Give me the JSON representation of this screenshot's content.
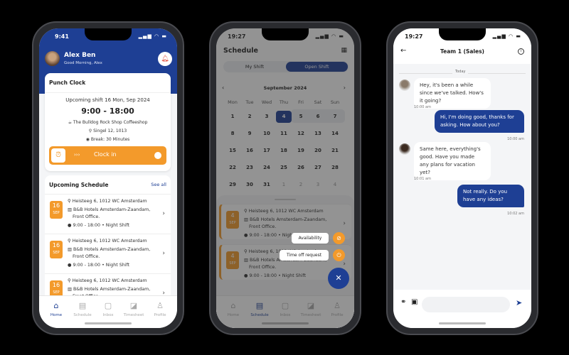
{
  "colors": {
    "primary": "#1e3f94",
    "accent": "#f39a2b",
    "background": "#000000"
  },
  "home": {
    "status_time": "9:41",
    "user_name": "Alex Ben",
    "greeting": "Good Morning, Alex",
    "punch_clock": {
      "title": "Punch Clock",
      "upcoming": "Upcoming shift 16 Mon, Sep 2024",
      "time": "9:00 - 18:00",
      "shop": "The Bulldog Rock Shop Coffeeshop",
      "address": "Singel 12, 1013",
      "break": "Break: 30 Minutes",
      "clock_in": "Clock in",
      "arrows": "›››"
    },
    "schedule": {
      "title": "Upcoming Schedule",
      "see_all": "See all",
      "items": [
        {
          "day": "16",
          "month": "SEP",
          "address": "Heisteeg 6, 1012 WC Amsterdam",
          "hotel": "B&B Hotels Amsterdam-Zaandam,",
          "dept": "Front Office.",
          "shift": "9:00 - 18:00 • Night Shift"
        },
        {
          "day": "16",
          "month": "SEP",
          "address": "Heisteeg 6, 1012 WC Amsterdam",
          "hotel": "B&B Hotels Amsterdam-Zaandam,",
          "dept": "Front Office.",
          "shift": "9:00 - 18:00 • Night Shift"
        },
        {
          "day": "16",
          "month": "SEP",
          "address": "Heisteeg 6, 1012 WC Amsterdam",
          "hotel": "B&B Hotels Amsterdam-Zaandam,",
          "dept": "Front Office.",
          "shift": "9:00 - 18:00 • Night Shift"
        }
      ]
    }
  },
  "nav": [
    "Home",
    "Schedule",
    "Inbox",
    "Timesheet",
    "Profile"
  ],
  "schedule_screen": {
    "status_time": "19:27",
    "title": "Schedule",
    "tabs": [
      "My Shift",
      "Open Shift"
    ],
    "active_tab": "Open Shift",
    "month": "September 2024",
    "weekdays": [
      "Mon",
      "Tue",
      "Wed",
      "Thu",
      "Fri",
      "Sat",
      "Sun"
    ],
    "weeks": [
      [
        "1",
        "2",
        "3",
        "4",
        "5",
        "6",
        "7"
      ],
      [
        "8",
        "9",
        "10",
        "11",
        "12",
        "13",
        "14"
      ],
      [
        "15",
        "16",
        "17",
        "18",
        "19",
        "20",
        "21"
      ],
      [
        "22",
        "23",
        "24",
        "25",
        "26",
        "27",
        "28"
      ],
      [
        "29",
        "30",
        "31",
        "1",
        "2",
        "3",
        "4"
      ]
    ],
    "selected_day": "4",
    "items": [
      {
        "day": "4",
        "month": "SEP",
        "address": "Heisteeg 6, 1012 WC Amsterdam",
        "hotel": "B&B Hotels Amsterdam-Zaandam,",
        "dept": "Front Office.",
        "shift": "9:00 - 18:00 • Night Shift"
      },
      {
        "day": "4",
        "month": "SEP",
        "address": "Heisteeg 6, 1012 WC Amsterdam",
        "hotel": "B&B Hotels Amsterdam-Zaandam,",
        "dept": "Front Office.",
        "shift": "9:00 - 18:00 • Night Shift"
      }
    ],
    "fab_actions": [
      "Availability",
      "Time off request"
    ]
  },
  "chat": {
    "status_time": "19:27",
    "title": "Team 1 (Sales)",
    "date": "Today",
    "messages": [
      {
        "dir": "in",
        "text": "Hey, it's been a while since we've talked. How's it going?",
        "time": "10:00 am"
      },
      {
        "dir": "out",
        "text": "Hi, I'm doing good, thanks for asking. How about you?",
        "time": "10:00 am"
      },
      {
        "dir": "in",
        "text": "Same here, everything's good. Have you made any plans for vacation yet?",
        "time": "10:01 am"
      },
      {
        "dir": "out",
        "text": "Not really. Do you have any ideas?",
        "time": "10:02 am"
      }
    ],
    "input_placeholder": ""
  }
}
